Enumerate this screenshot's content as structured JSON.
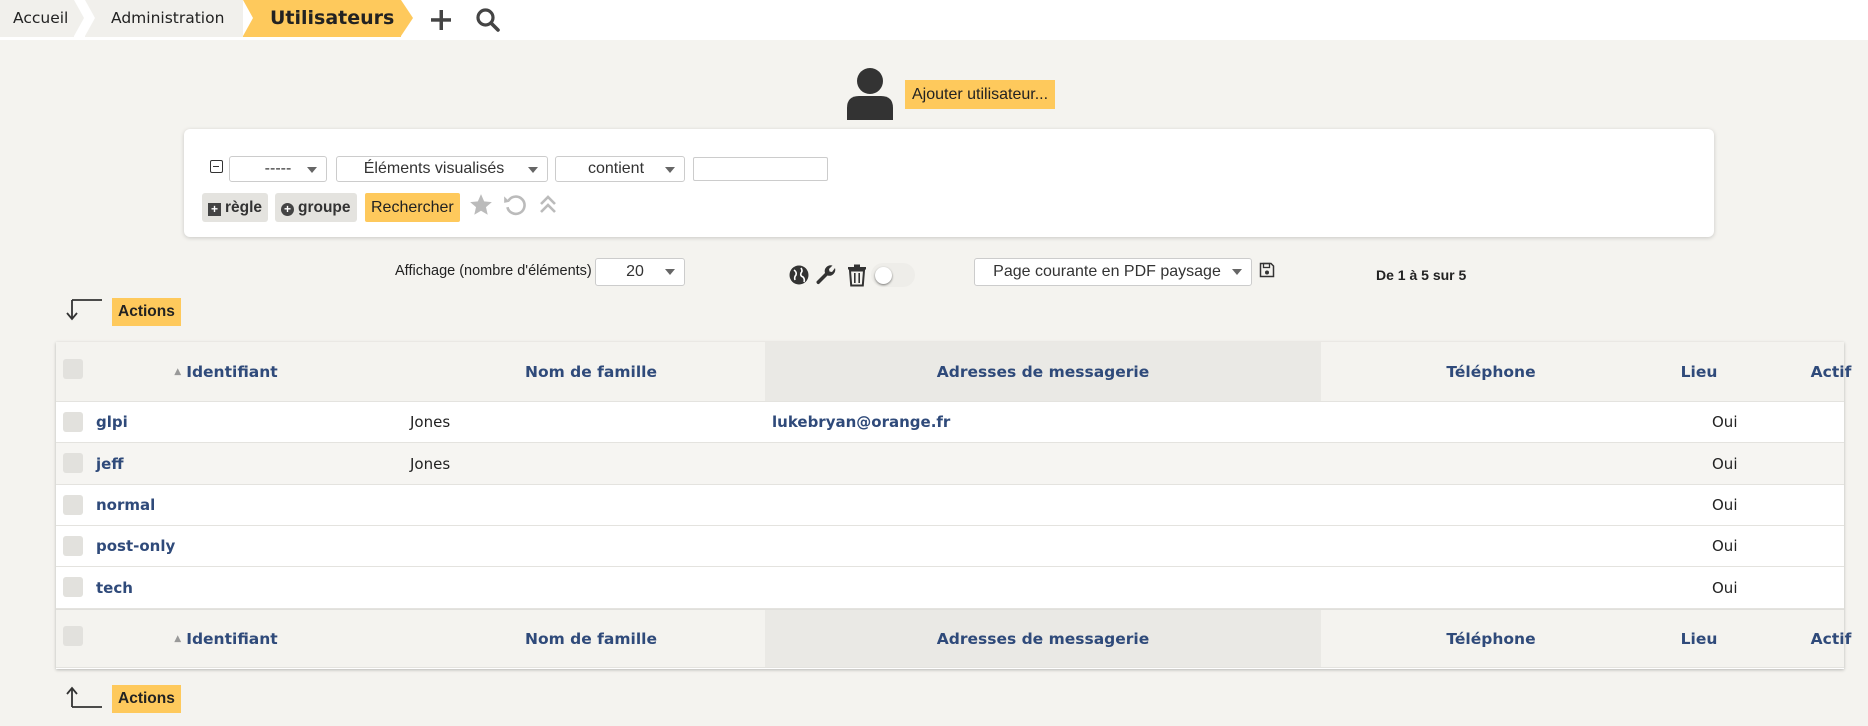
{
  "breadcrumb": {
    "items": [
      {
        "label": "Accueil"
      },
      {
        "label": "Administration"
      },
      {
        "label": "Utilisateurs"
      }
    ]
  },
  "icons": {
    "add": "plus-icon",
    "search": "search-icon",
    "avatar": "user-icon",
    "globe": "globe-icon",
    "wrench": "wrench-icon",
    "trash": "trash-icon",
    "save": "save-icon",
    "star": "star-icon",
    "undo": "undo-icon",
    "collapse": "double-chevron-up-icon"
  },
  "add_user": {
    "label": "Ajouter utilisateur..."
  },
  "search": {
    "field_select": "-----",
    "item_select": "Éléments visualisés",
    "operator_select": "contient",
    "value": "",
    "rule_button": "règle",
    "group_button": "groupe",
    "search_button": "Rechercher"
  },
  "display": {
    "label": "Affichage (nombre d'éléments)",
    "count": "20",
    "export_select": "Page courante en PDF paysage",
    "pagination": "De 1 à 5 sur 5"
  },
  "actions_label": "Actions",
  "table": {
    "columns": [
      "Identifiant",
      "Nom de famille",
      "Adresses de messagerie",
      "Téléphone",
      "Lieu",
      "Actif"
    ],
    "rows": [
      {
        "login": "glpi",
        "lastname": "Jones",
        "email": "lukebryan@orange.fr",
        "phone": "",
        "location": "",
        "active": "Oui"
      },
      {
        "login": "jeff",
        "lastname": "Jones",
        "email": "",
        "phone": "",
        "location": "",
        "active": "Oui"
      },
      {
        "login": "normal",
        "lastname": "",
        "email": "",
        "phone": "",
        "location": "",
        "active": "Oui"
      },
      {
        "login": "post-only",
        "lastname": "",
        "email": "",
        "phone": "",
        "location": "",
        "active": "Oui"
      },
      {
        "login": "tech",
        "lastname": "",
        "email": "",
        "phone": "",
        "location": "",
        "active": "Oui"
      }
    ]
  },
  "colors": {
    "accent": "#fec95c",
    "link": "#2f4a7a",
    "background": "#f4f3ef"
  }
}
